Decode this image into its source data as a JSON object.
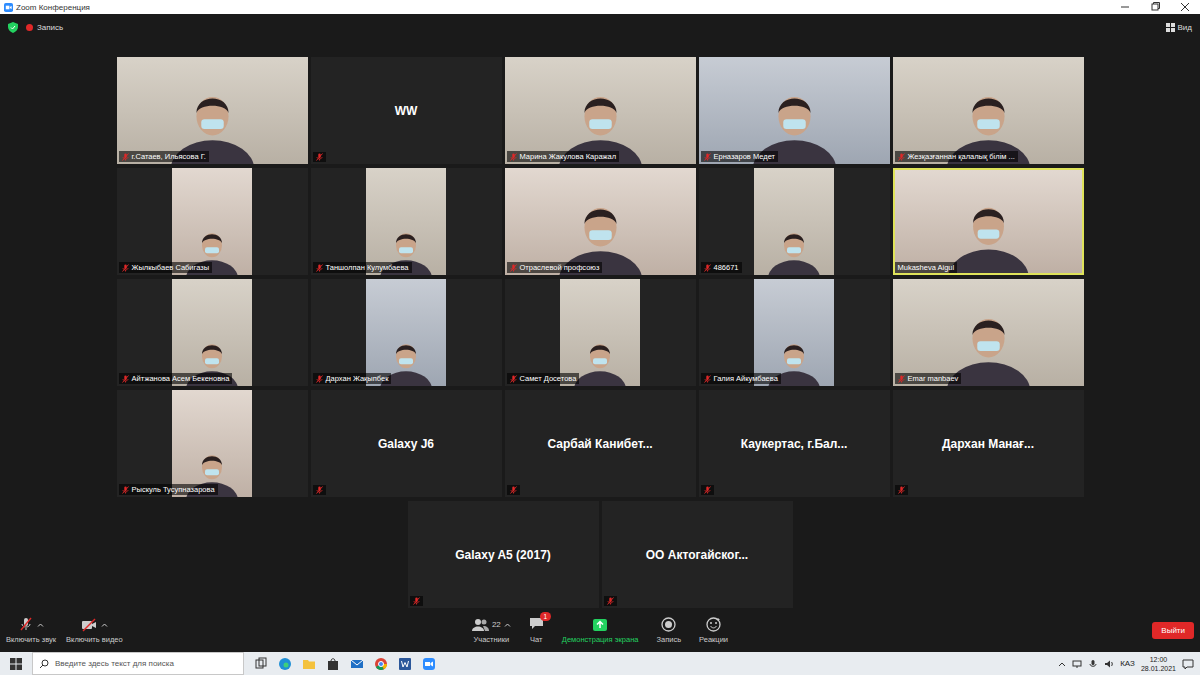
{
  "window": {
    "title": "Zoom Конференция"
  },
  "top_bar": {
    "recording": "Запись",
    "view": "Вид"
  },
  "tiles": [
    {
      "name": "г.Сатаев,  Ильясова Г.",
      "kind": "video",
      "muted": true,
      "active": false
    },
    {
      "name": "WW",
      "kind": "name",
      "muted": true,
      "active": false
    },
    {
      "name": "Марина Жакулова Каражал",
      "kind": "video",
      "muted": true,
      "active": false
    },
    {
      "name": "Ерназаров Медет",
      "kind": "video",
      "muted": true,
      "active": false
    },
    {
      "name": "Жезқазғаннан қалалық білім ...",
      "kind": "video",
      "muted": true,
      "active": false
    },
    {
      "name": "Жылкыбаев Сабигазы",
      "kind": "narrow",
      "muted": true,
      "active": false
    },
    {
      "name": "Таншолпан Кулумбаева",
      "kind": "narrow",
      "muted": true,
      "active": false
    },
    {
      "name": "Отраслевой профсоюз",
      "kind": "video",
      "muted": true,
      "active": false
    },
    {
      "name": "486671",
      "kind": "narrow",
      "muted": true,
      "active": false
    },
    {
      "name": "Mukasheva Aigul",
      "kind": "video",
      "muted": false,
      "active": true
    },
    {
      "name": "Айтжанова Асем Бекеновна",
      "kind": "narrow",
      "muted": true,
      "active": false
    },
    {
      "name": "Дархан Жақыпбек",
      "kind": "narrow",
      "muted": true,
      "active": false
    },
    {
      "name": "Самет Досетова",
      "kind": "narrow",
      "muted": true,
      "active": false
    },
    {
      "name": "Галия Айкумбаева",
      "kind": "narrow",
      "muted": true,
      "active": false
    },
    {
      "name": "Emar manbaev",
      "kind": "video",
      "muted": true,
      "active": false
    },
    {
      "name": "Рыскуль Тусупназарова",
      "kind": "narrow",
      "muted": true,
      "active": false
    },
    {
      "name": "Galaxy J6",
      "kind": "name",
      "muted": true,
      "active": false
    },
    {
      "name": "Сарбай  Канибет...",
      "kind": "name",
      "muted": true,
      "active": false
    },
    {
      "name": "Каукертас,  г.Бал...",
      "kind": "name",
      "muted": true,
      "active": false
    },
    {
      "name": "Дархан  Манағ...",
      "kind": "name",
      "muted": true,
      "active": false
    },
    {
      "name": "Galaxy A5 (2017)",
      "kind": "name",
      "muted": true,
      "active": false
    },
    {
      "name": "ОО  Актогайског...",
      "kind": "name",
      "muted": true,
      "active": false
    }
  ],
  "toolbar": {
    "left": [
      {
        "label": "Включить звук",
        "kind": "audio"
      },
      {
        "label": "Включить видео",
        "kind": "video"
      }
    ],
    "center": [
      {
        "label": "Участники",
        "kind": "participants",
        "count": "22"
      },
      {
        "label": "Чат",
        "kind": "chat",
        "badge": "1"
      },
      {
        "label": "Демонстрация экрана",
        "kind": "share"
      },
      {
        "label": "Запись",
        "kind": "record"
      },
      {
        "label": "Реакции",
        "kind": "reactions"
      }
    ],
    "leave": "Выйти"
  },
  "taskbar": {
    "search_placeholder": "Введите здесь текст для поиска",
    "language": "КАЗ",
    "time": "12:00",
    "date": "28.01.2021"
  }
}
